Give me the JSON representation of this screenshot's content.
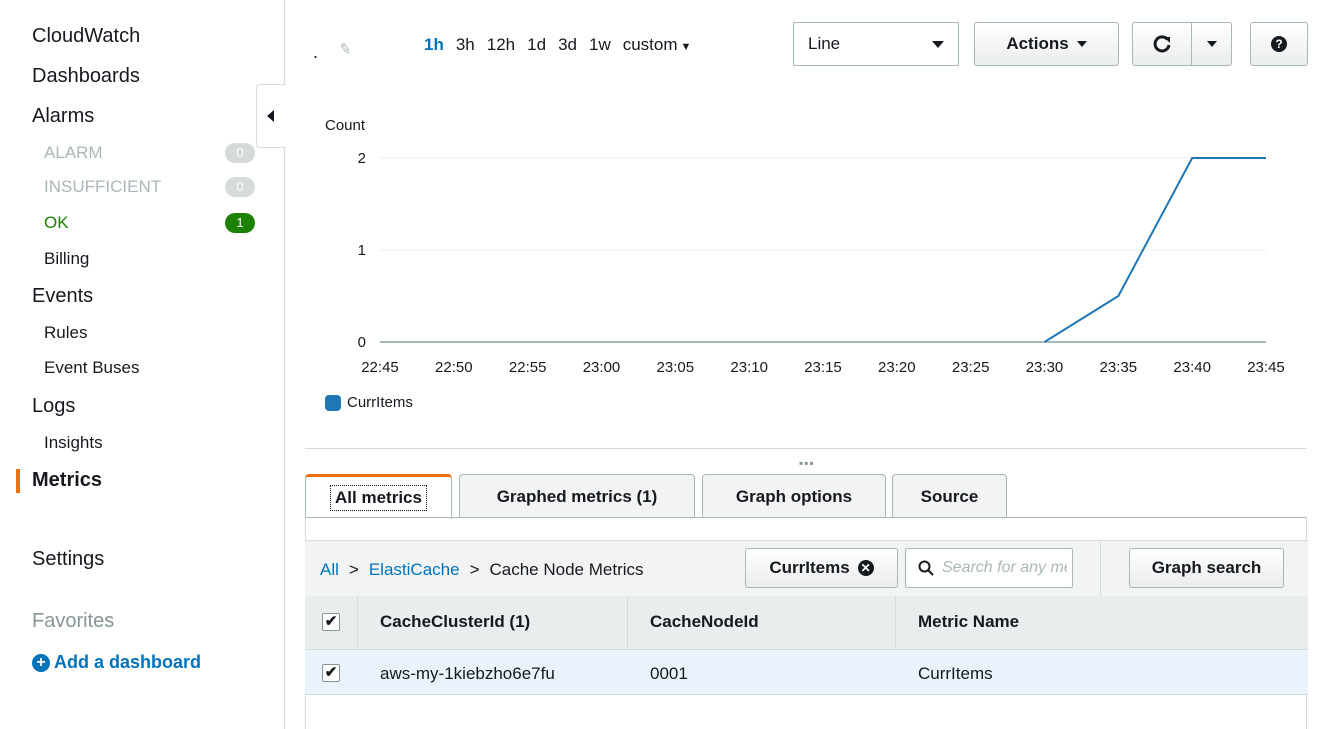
{
  "sidebar": {
    "cloudwatch": "CloudWatch",
    "dashboards": "Dashboards",
    "alarms": "Alarms",
    "alarm": "ALARM",
    "alarm_count": "0",
    "insufficient": "INSUFFICIENT",
    "insufficient_count": "0",
    "ok": "OK",
    "ok_count": "1",
    "billing": "Billing",
    "events": "Events",
    "rules": "Rules",
    "event_buses": "Event Buses",
    "logs": "Logs",
    "insights": "Insights",
    "metrics": "Metrics",
    "settings": "Settings",
    "favorites": "Favorites",
    "add_dashboard": "Add a dashboard"
  },
  "toolbar": {
    "title": ".",
    "ranges": [
      "1h",
      "3h",
      "12h",
      "1d",
      "3d",
      "1w"
    ],
    "selected_range": "1h",
    "custom": "custom",
    "graph_type": "Line",
    "actions": "Actions",
    "help": "?"
  },
  "chart_data": {
    "type": "line",
    "ylabel": "Count",
    "ylim": [
      0,
      2
    ],
    "yticks": [
      "0",
      "1",
      "2"
    ],
    "x": [
      "22:45",
      "22:50",
      "22:55",
      "23:00",
      "23:05",
      "23:10",
      "23:15",
      "23:20",
      "23:25",
      "23:30",
      "23:35",
      "23:40",
      "23:45"
    ],
    "series": [
      {
        "name": "CurrItems",
        "color": "#1f77b4",
        "points": [
          [
            "23:30",
            0
          ],
          [
            "23:35",
            0.5
          ],
          [
            "23:40",
            2
          ],
          [
            "23:45",
            2
          ]
        ]
      }
    ],
    "grid": true,
    "legend": "bottom-left"
  },
  "tabs": [
    {
      "label": "All metrics",
      "active": true
    },
    {
      "label": "Graphed metrics (1)",
      "active": false
    },
    {
      "label": "Graph options",
      "active": false
    },
    {
      "label": "Source",
      "active": false
    }
  ],
  "browse": {
    "crumb_all": "All",
    "crumb_sep": ">",
    "crumb_service": "ElastiCache",
    "crumb_group": "Cache Node Metrics",
    "chip": "CurrItems",
    "search_placeholder": "Search for any metric, dimension or resource id",
    "graph_search": "Graph search"
  },
  "table": {
    "headers": [
      "CacheClusterId (1)",
      "CacheNodeId",
      "Metric Name"
    ],
    "rows": [
      {
        "checked": true,
        "cells": [
          "aws-my-1kiebzho6e7fu",
          "0001",
          "CurrItems"
        ]
      }
    ]
  }
}
